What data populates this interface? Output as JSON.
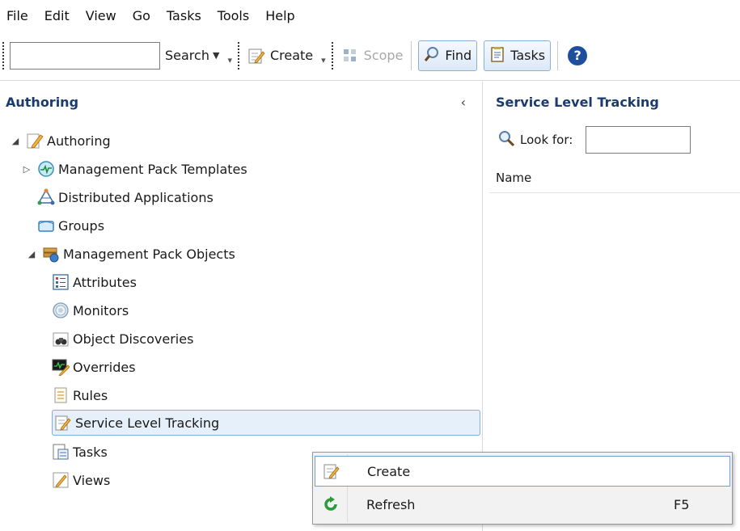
{
  "menubar": {
    "items": [
      "File",
      "Edit",
      "View",
      "Go",
      "Tasks",
      "Tools",
      "Help"
    ]
  },
  "toolbar": {
    "search_value": "",
    "search_label": "Search",
    "create_label": "Create",
    "scope_label": "Scope",
    "find_label": "Find",
    "tasks_label": "Tasks"
  },
  "left_pane": {
    "title": "Authoring",
    "tree": [
      {
        "label": "Authoring",
        "icon": "pencil-icon",
        "expander": "expanded"
      },
      {
        "label": "Management Pack Templates",
        "icon": "template-icon",
        "expander": "collapsed"
      },
      {
        "label": "Distributed Applications",
        "icon": "distributed-app-icon",
        "expander": "none"
      },
      {
        "label": "Groups",
        "icon": "groups-icon",
        "expander": "none"
      },
      {
        "label": "Management Pack Objects",
        "icon": "pack-objects-icon",
        "expander": "expanded"
      },
      {
        "label": "Attributes",
        "icon": "attributes-icon",
        "expander": "none"
      },
      {
        "label": "Monitors",
        "icon": "monitors-icon",
        "expander": "none"
      },
      {
        "label": "Object Discoveries",
        "icon": "binoculars-icon",
        "expander": "none"
      },
      {
        "label": "Overrides",
        "icon": "overrides-icon",
        "expander": "none"
      },
      {
        "label": "Rules",
        "icon": "rules-icon",
        "expander": "none"
      },
      {
        "label": "Service Level Tracking",
        "icon": "service-level-icon",
        "expander": "none",
        "selected": true
      },
      {
        "label": "Tasks",
        "icon": "tasks-icon",
        "expander": "none"
      },
      {
        "label": "Views",
        "icon": "views-icon",
        "expander": "none"
      }
    ]
  },
  "right_pane": {
    "title": "Service Level Tracking",
    "look_for_label": "Look for:",
    "look_for_value": "",
    "column_name": "Name"
  },
  "context_menu": {
    "items": [
      {
        "label": "Create",
        "shortcut": "",
        "icon": "create-icon",
        "highlighted": true
      },
      {
        "label": "Refresh",
        "shortcut": "F5",
        "icon": "refresh-icon",
        "highlighted": false
      }
    ]
  },
  "colors": {
    "selection_bg": "#e5f0fb",
    "selection_border": "#84acdd",
    "header_text": "#1a3b6b",
    "button_border": "#8bb0d6"
  }
}
